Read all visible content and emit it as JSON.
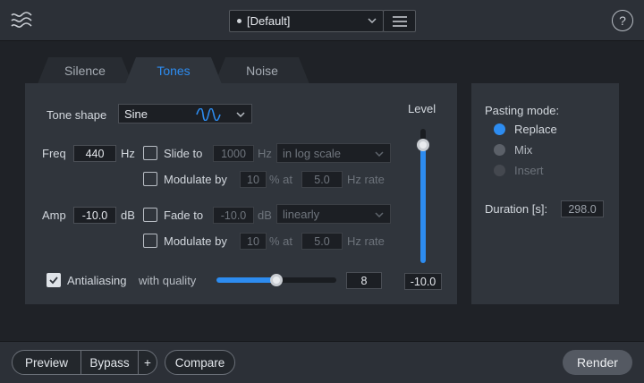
{
  "header": {
    "preset": "[Default]",
    "help": "?"
  },
  "tabs": [
    {
      "label": "Silence",
      "active": false
    },
    {
      "label": "Tones",
      "active": true
    },
    {
      "label": "Noise",
      "active": false
    }
  ],
  "tones": {
    "tone_shape_label": "Tone shape",
    "tone_shape_value": "Sine",
    "freq": {
      "label": "Freq",
      "value": "440",
      "unit": "Hz",
      "slide_label": "Slide to",
      "slide_value": "1000",
      "slide_unit": "Hz",
      "slide_scale": "in log scale",
      "mod_label": "Modulate by",
      "mod_value": "10",
      "mod_unit": "% at",
      "mod_rate": "5.0",
      "mod_rate_unit": "Hz rate"
    },
    "amp": {
      "label": "Amp",
      "value": "-10.0",
      "unit": "dB",
      "fade_label": "Fade to",
      "fade_value": "-10.0",
      "fade_unit": "dB",
      "fade_curve": "linearly",
      "mod_label": "Modulate by",
      "mod_value": "10",
      "mod_unit": "% at",
      "mod_rate": "5.0",
      "mod_rate_unit": "Hz rate"
    },
    "antialiasing_label": "Antialiasing",
    "quality_label": "with quality",
    "quality_value": "8",
    "quality_fraction": 0.5,
    "level_label": "Level",
    "level_value": "-10.0",
    "level_fraction": 0.88
  },
  "pasting": {
    "title": "Pasting mode:",
    "options": [
      {
        "label": "Replace",
        "selected": true,
        "enabled": true
      },
      {
        "label": "Mix",
        "selected": false,
        "enabled": true
      },
      {
        "label": "Insert",
        "selected": false,
        "enabled": false
      }
    ],
    "duration_label": "Duration [s]:",
    "duration_value": "298.0"
  },
  "footer": {
    "preview": "Preview",
    "bypass": "Bypass",
    "plus": "+",
    "compare": "Compare",
    "render": "Render"
  },
  "colors": {
    "accent": "#2d8cf0",
    "panel": "#30353c",
    "background": "#1f2227"
  }
}
